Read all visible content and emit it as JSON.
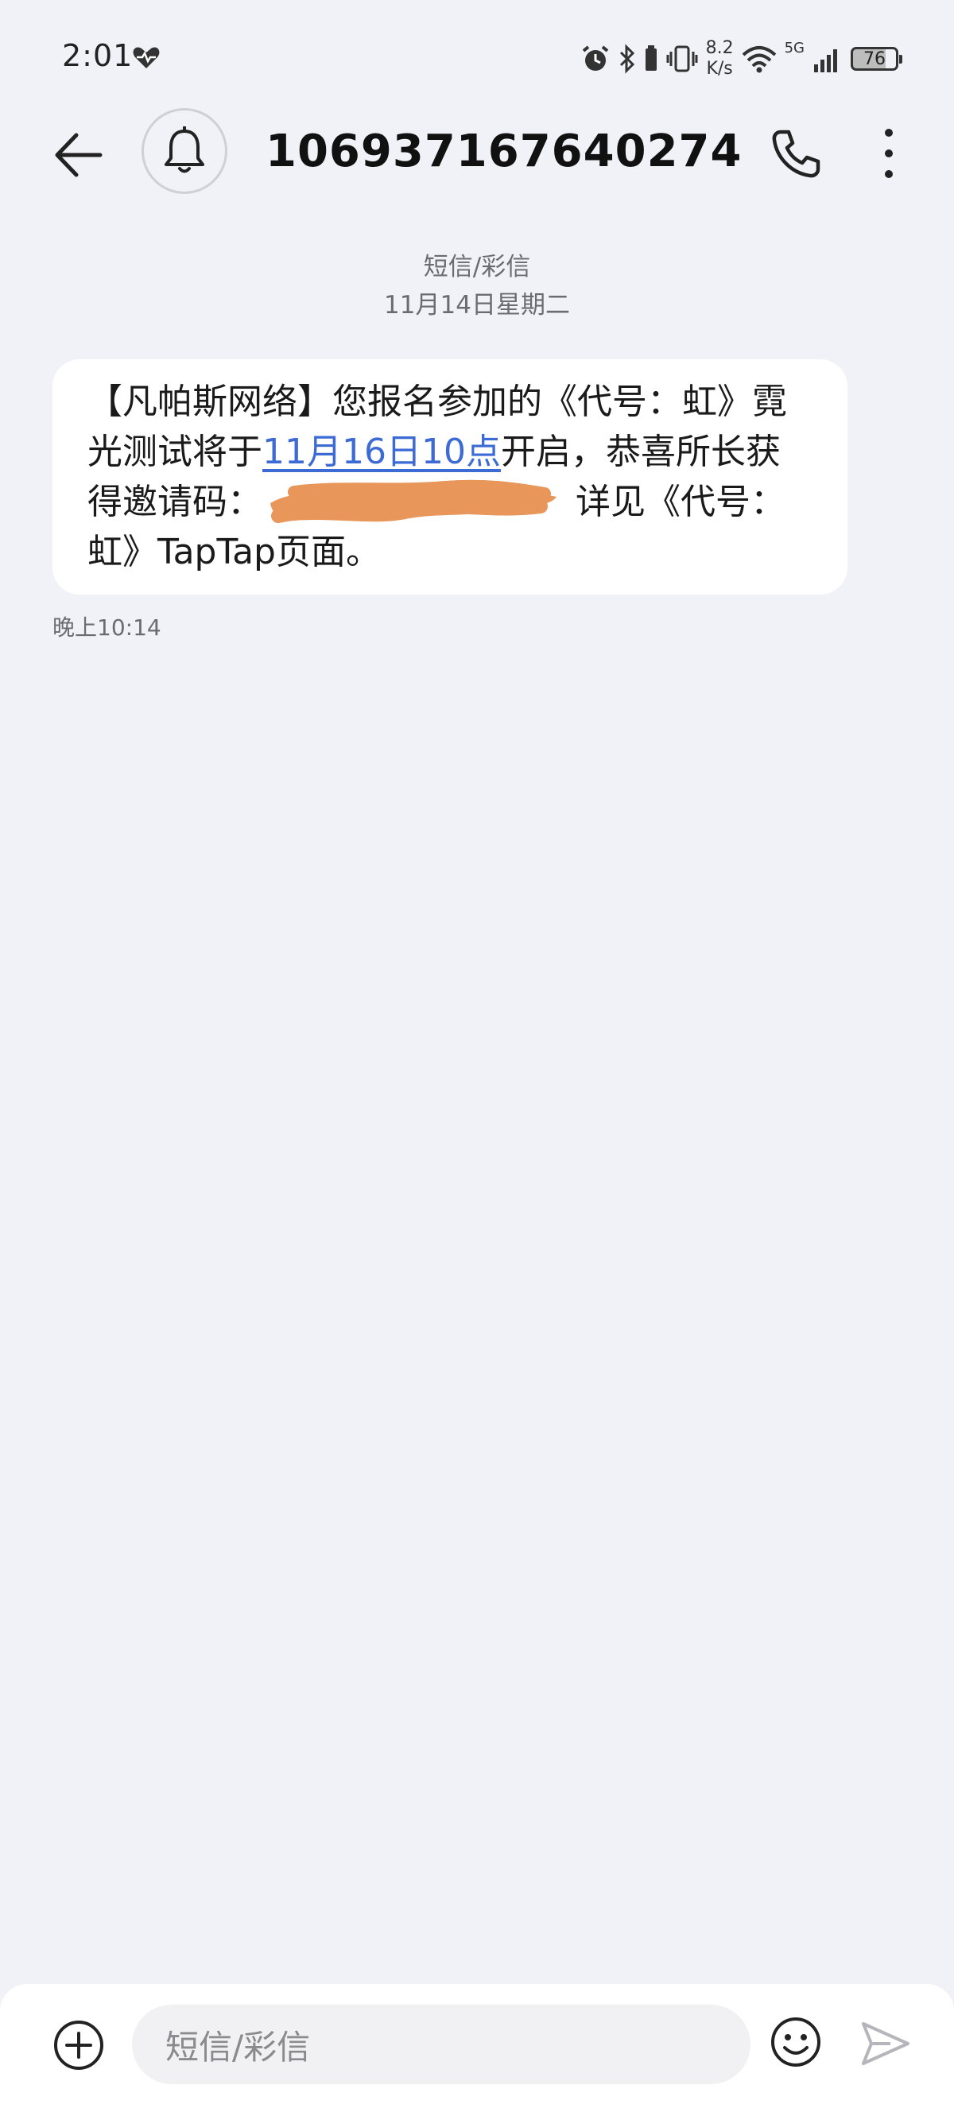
{
  "status_bar": {
    "time": "2:01",
    "net_speed_value": "8.2",
    "net_speed_unit": "K/s",
    "network": "5G",
    "battery": "76"
  },
  "header": {
    "contact": "106937167640274"
  },
  "thread": {
    "type_label": "短信/彩信",
    "date": "11月14日星期二"
  },
  "message": {
    "part1": "【凡帕斯网络】您报名参加的《代号：虹》霓光测试将于",
    "link": "11月16日10点",
    "part2": "开启，恭喜所长获得邀请码：",
    "part3": " 详见《代号：虹》TapTap页面。",
    "time": "晚上10:14"
  },
  "composer": {
    "placeholder": "短信/彩信"
  },
  "colors": {
    "background": "#f1f2f7",
    "bubble": "#ffffff",
    "link": "#3d6bd6",
    "redaction": "#e8965a"
  }
}
